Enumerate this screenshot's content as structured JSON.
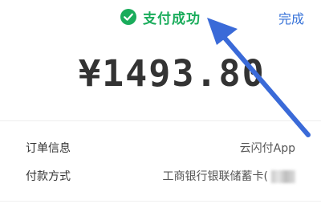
{
  "header": {
    "status_text": "支付成功",
    "done_label": "完成"
  },
  "payment": {
    "amount": "¥1493.80"
  },
  "details": {
    "rows": [
      {
        "label": "订单信息",
        "value": "云闪付App"
      },
      {
        "label": "付款方式",
        "value": "工商银行银联储蓄卡("
      }
    ]
  },
  "colors": {
    "success": "#1aac5b",
    "link": "#3571d8",
    "annotation_arrow": "#3a6ad8"
  },
  "icons": {
    "status": "check-circle-icon",
    "annotation": "arrow-annotation"
  }
}
